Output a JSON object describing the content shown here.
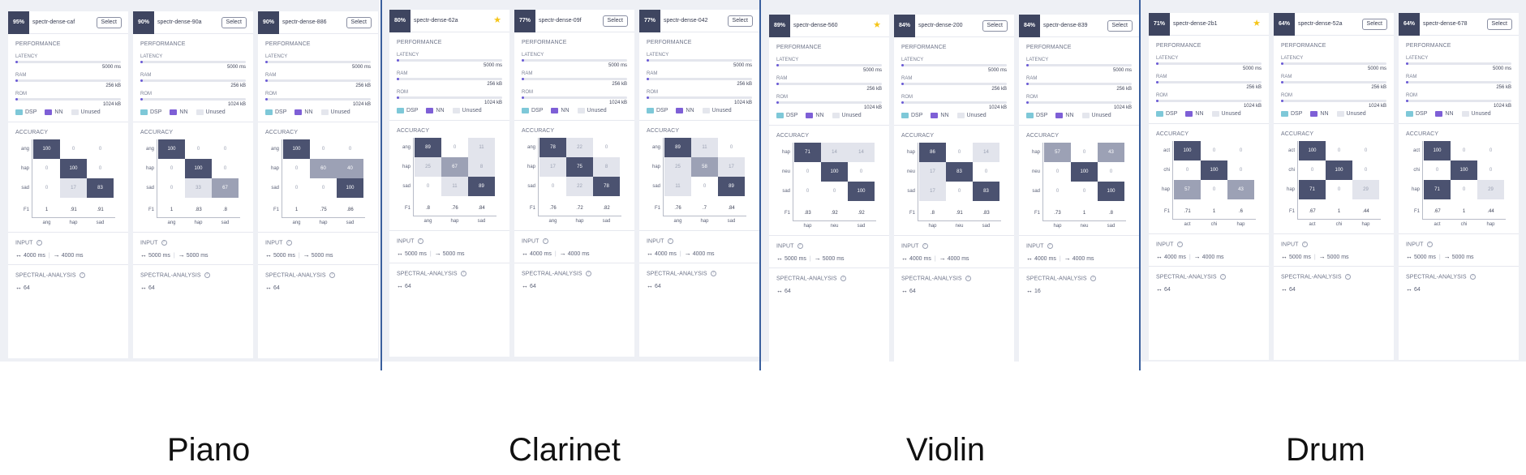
{
  "sections": {
    "performance": "PERFORMANCE",
    "latency": "LATENCY",
    "ram": "RAM",
    "rom": "ROM",
    "accuracy": "ACCURACY",
    "input": "INPUT",
    "spectral": "SPECTRAL-ANALYSIS",
    "f1": "F1",
    "latency_max": "5000 ms",
    "ram_max": "256 kB",
    "rom_max": "1024 kB",
    "select": "Select"
  },
  "legend": [
    {
      "label": "DSP",
      "color": "#7ec8d8"
    },
    {
      "label": "NN",
      "color": "#7e5fd6"
    },
    {
      "label": "Unused",
      "color": "#e4e6ed"
    }
  ],
  "colors": {
    "badge": "#3e4560",
    "divider": "#3a5f9d",
    "bar_fill": "#6b5bd6",
    "matrix_high": "#4b5270",
    "matrix_mid": "#9ca1b5",
    "matrix_low": "#e2e4ec",
    "star": "#f5c518"
  },
  "groups": [
    {
      "instrument": "Piano",
      "cards": [
        {
          "score": "95%",
          "name": "spectr-dense-caf",
          "starred": false,
          "classes": [
            "ang",
            "hap",
            "sad"
          ],
          "matrix": [
            [
              "100",
              "0",
              "0"
            ],
            [
              "0",
              "100",
              "0"
            ],
            [
              "0",
              "17",
              "83"
            ]
          ],
          "f1": [
            "1",
            ".91",
            ".91"
          ],
          "input_a": "4000 ms",
          "input_b": "4000 ms",
          "spectral": "64",
          "latency_fill": 0.01,
          "ram_fill": 0.01,
          "rom_fill": 0.01
        },
        {
          "score": "90%",
          "name": "spectr-dense-90a",
          "starred": false,
          "classes": [
            "ang",
            "hap",
            "sad"
          ],
          "matrix": [
            [
              "100",
              "0",
              "0"
            ],
            [
              "0",
              "100",
              "0"
            ],
            [
              "0",
              "33",
              "67"
            ]
          ],
          "f1": [
            "1",
            ".83",
            ".8"
          ],
          "input_a": "5000 ms",
          "input_b": "5000 ms",
          "spectral": "64",
          "latency_fill": 0.01,
          "ram_fill": 0.01,
          "rom_fill": 0.01
        },
        {
          "score": "90%",
          "name": "spectr-dense-886",
          "starred": false,
          "classes": [
            "ang",
            "hap",
            "sad"
          ],
          "matrix": [
            [
              "100",
              "0",
              "0"
            ],
            [
              "0",
              "60",
              "40"
            ],
            [
              "0",
              "0",
              "100"
            ]
          ],
          "f1": [
            "1",
            ".75",
            ".86"
          ],
          "input_a": "5000 ms",
          "input_b": "5000 ms",
          "spectral": "64",
          "latency_fill": 0.01,
          "ram_fill": 0.01,
          "rom_fill": 0.01
        }
      ]
    },
    {
      "instrument": "Clarinet",
      "cards": [
        {
          "score": "80%",
          "name": "spectr-dense-62a",
          "starred": true,
          "classes": [
            "ang",
            "hap",
            "sad"
          ],
          "matrix": [
            [
              "89",
              "0",
              "11"
            ],
            [
              "25",
              "67",
              "8"
            ],
            [
              "0",
              "11",
              "89"
            ]
          ],
          "f1": [
            ".8",
            ".76",
            ".84"
          ],
          "input_a": "5000 ms",
          "input_b": "5000 ms",
          "spectral": "64",
          "latency_fill": 0.01,
          "ram_fill": 0.01,
          "rom_fill": 0.01
        },
        {
          "score": "77%",
          "name": "spectr-dense-09f",
          "starred": false,
          "classes": [
            "ang",
            "hap",
            "sad"
          ],
          "matrix": [
            [
              "78",
              "22",
              "0"
            ],
            [
              "17",
              "75",
              "8"
            ],
            [
              "0",
              "22",
              "78"
            ]
          ],
          "f1": [
            ".76",
            ".72",
            ".82"
          ],
          "input_a": "4000 ms",
          "input_b": "4000 ms",
          "spectral": "64",
          "latency_fill": 0.01,
          "ram_fill": 0.01,
          "rom_fill": 0.01
        },
        {
          "score": "77%",
          "name": "spectr-dense-042",
          "starred": false,
          "classes": [
            "ang",
            "hap",
            "sad"
          ],
          "matrix": [
            [
              "89",
              "11",
              "0"
            ],
            [
              "25",
              "58",
              "17"
            ],
            [
              "11",
              "0",
              "89"
            ]
          ],
          "f1": [
            ".76",
            ".7",
            ".84"
          ],
          "input_a": "4000 ms",
          "input_b": "4000 ms",
          "spectral": "64",
          "latency_fill": 0.01,
          "ram_fill": 0.01,
          "rom_fill": 0.01
        }
      ]
    },
    {
      "instrument": "Violin",
      "cards": [
        {
          "score": "89%",
          "name": "spectr-dense-560",
          "starred": true,
          "classes": [
            "hap",
            "neu",
            "sad"
          ],
          "matrix": [
            [
              "71",
              "14",
              "14"
            ],
            [
              "0",
              "100",
              "0"
            ],
            [
              "0",
              "0",
              "100"
            ]
          ],
          "f1": [
            ".83",
            ".92",
            ".92"
          ],
          "input_a": "5000 ms",
          "input_b": "5000 ms",
          "spectral": "64",
          "latency_fill": 0.01,
          "ram_fill": 0.01,
          "rom_fill": 0.01
        },
        {
          "score": "84%",
          "name": "spectr-dense-200",
          "starred": false,
          "classes": [
            "hap",
            "neu",
            "sad"
          ],
          "matrix": [
            [
              "86",
              "0",
              "14"
            ],
            [
              "17",
              "83",
              "0"
            ],
            [
              "17",
              "0",
              "83"
            ]
          ],
          "f1": [
            ".8",
            ".91",
            ".83"
          ],
          "input_a": "4000 ms",
          "input_b": "4000 ms",
          "spectral": "64",
          "latency_fill": 0.01,
          "ram_fill": 0.01,
          "rom_fill": 0.01
        },
        {
          "score": "84%",
          "name": "spectr-dense-839",
          "starred": false,
          "classes": [
            "hap",
            "neu",
            "sad"
          ],
          "matrix": [
            [
              "57",
              "0",
              "43"
            ],
            [
              "0",
              "100",
              "0"
            ],
            [
              "0",
              "0",
              "100"
            ]
          ],
          "f1": [
            ".73",
            "1",
            ".8"
          ],
          "input_a": "4000 ms",
          "input_b": "4000 ms",
          "spectral": "16",
          "latency_fill": 0.01,
          "ram_fill": 0.01,
          "rom_fill": 0.01
        }
      ]
    },
    {
      "instrument": "Drum",
      "cards": [
        {
          "score": "71%",
          "name": "spectr-dense-2b1",
          "starred": true,
          "classes": [
            "act",
            "chi",
            "hap"
          ],
          "matrix": [
            [
              "100",
              "0",
              "0"
            ],
            [
              "0",
              "100",
              "0"
            ],
            [
              "57",
              "0",
              "43"
            ]
          ],
          "f1": [
            ".71",
            "1",
            ".6"
          ],
          "input_a": "4000 ms",
          "input_b": "4000 ms",
          "spectral": "64",
          "latency_fill": 0.01,
          "ram_fill": 0.01,
          "rom_fill": 0.01
        },
        {
          "score": "64%",
          "name": "spectr-dense-52a",
          "starred": false,
          "classes": [
            "act",
            "chi",
            "hap"
          ],
          "matrix": [
            [
              "100",
              "0",
              "0"
            ],
            [
              "0",
              "100",
              "0"
            ],
            [
              "71",
              "0",
              "29"
            ]
          ],
          "f1": [
            ".67",
            "1",
            ".44"
          ],
          "input_a": "5000 ms",
          "input_b": "5000 ms",
          "spectral": "64",
          "latency_fill": 0.01,
          "ram_fill": 0.01,
          "rom_fill": 0.01
        },
        {
          "score": "64%",
          "name": "spectr-dense-678",
          "starred": false,
          "classes": [
            "act",
            "chi",
            "hap"
          ],
          "matrix": [
            [
              "100",
              "0",
              "0"
            ],
            [
              "0",
              "100",
              "0"
            ],
            [
              "71",
              "0",
              "29"
            ]
          ],
          "f1": [
            ".67",
            "1",
            ".44"
          ],
          "input_a": "5000 ms",
          "input_b": "5000 ms",
          "spectral": "64",
          "latency_fill": 0.01,
          "ram_fill": 0.01,
          "rom_fill": 0.01
        }
      ]
    }
  ]
}
